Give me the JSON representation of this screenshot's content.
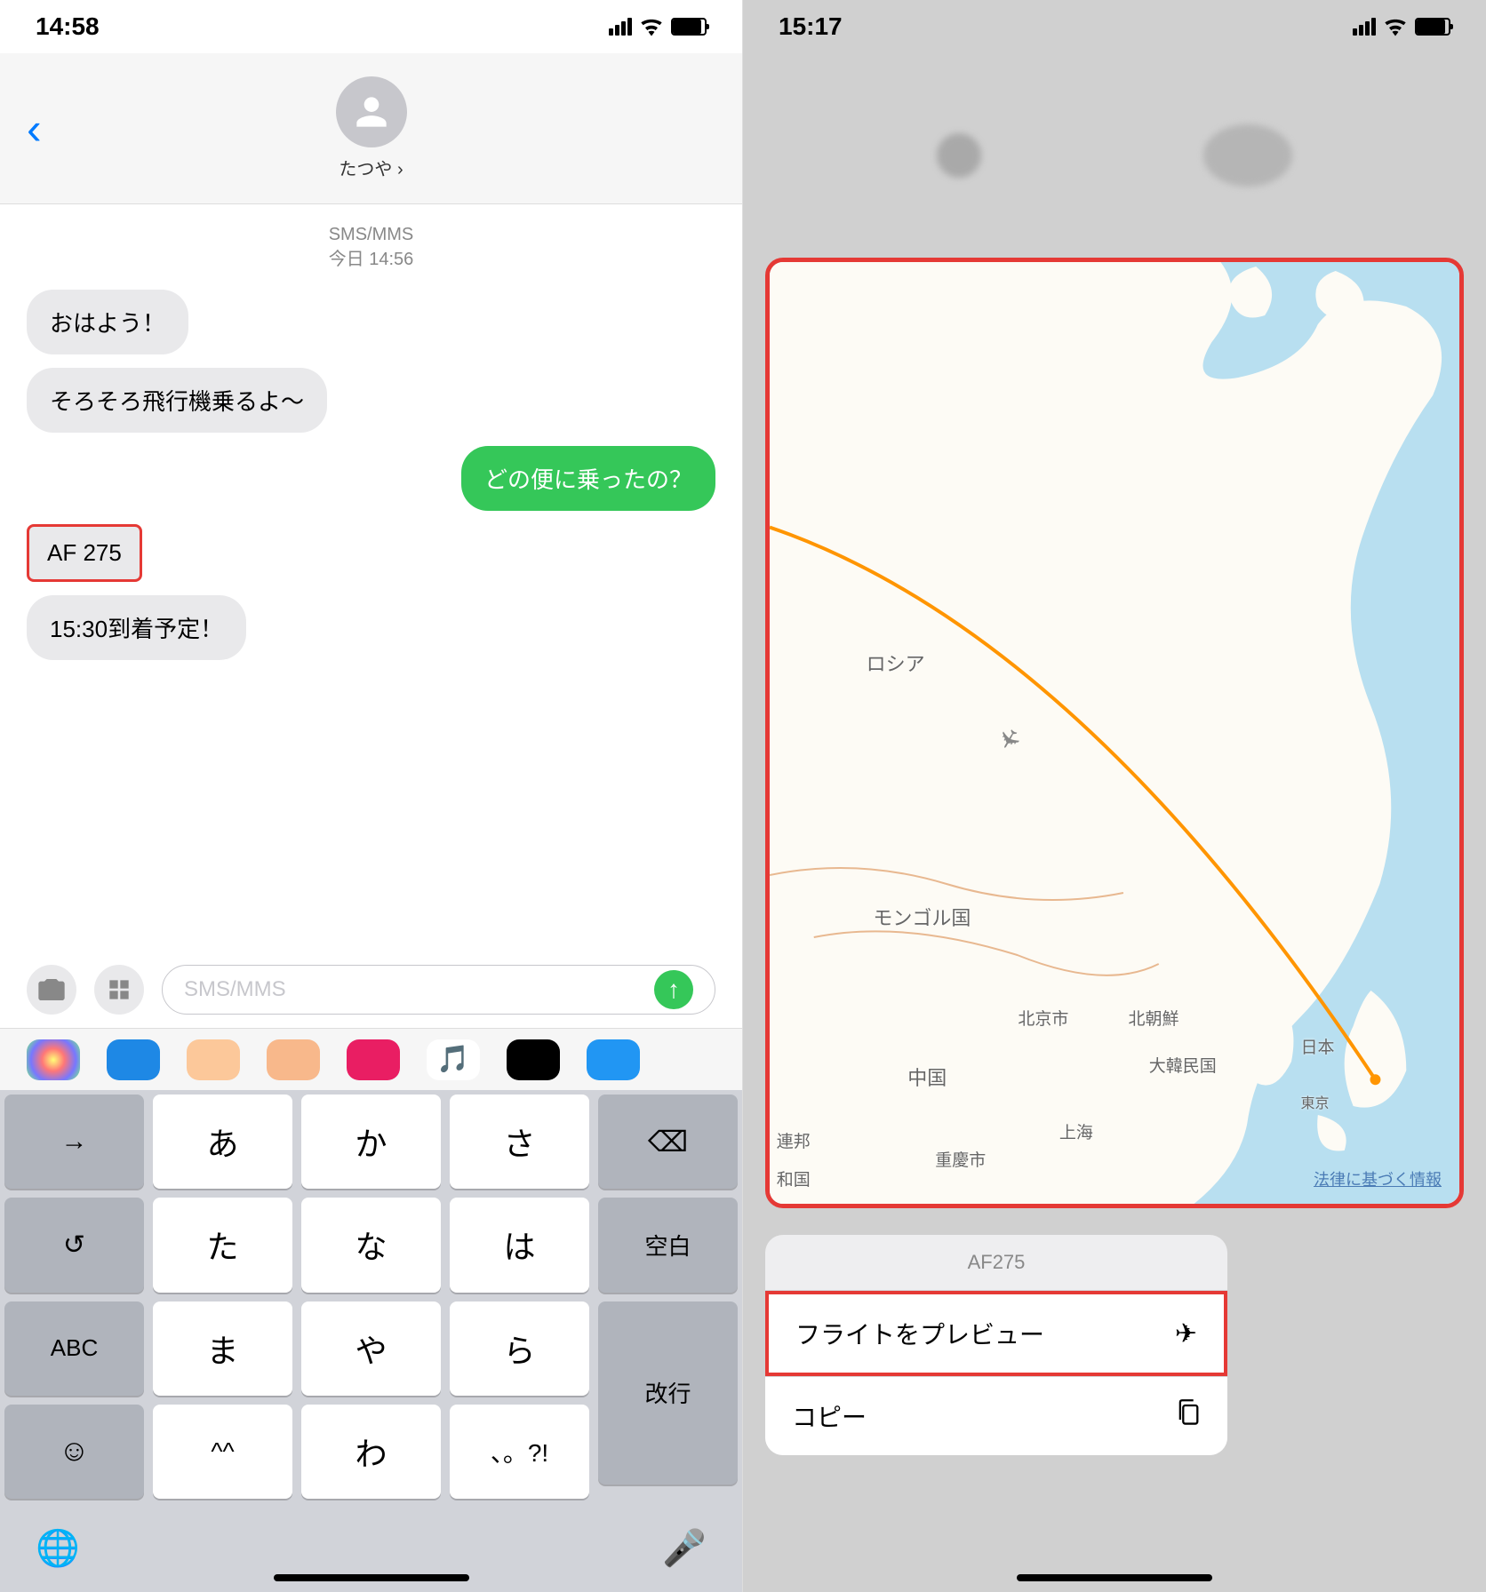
{
  "left": {
    "status": {
      "time": "14:58"
    },
    "header": {
      "contact_name": "たつや ›"
    },
    "thread": {
      "meta_line1": "SMS/MMS",
      "meta_line2": "今日 14:56",
      "messages": [
        {
          "text": "おはよう！",
          "dir": "in"
        },
        {
          "text": "そろそろ飛行機乗るよ〜",
          "dir": "in"
        },
        {
          "text": "どの便に乗ったの？",
          "dir": "out"
        },
        {
          "text": "AF 275",
          "dir": "in",
          "highlight": true
        },
        {
          "text": "15:30到着予定！",
          "dir": "in"
        }
      ]
    },
    "compose": {
      "placeholder": "SMS/MMS"
    },
    "keyboard": {
      "rows": [
        [
          "→",
          "あ",
          "か",
          "さ",
          "⌫"
        ],
        [
          "↺",
          "た",
          "な",
          "は",
          "空白"
        ],
        [
          "ABC",
          "ま",
          "や",
          "ら",
          "改行"
        ],
        [
          "☺",
          "^^",
          "わ",
          "、。?!",
          ""
        ]
      ]
    }
  },
  "right": {
    "status": {
      "time": "15:17"
    },
    "map": {
      "labels": {
        "russia": "ロシア",
        "mongolia": "モンゴル国",
        "china": "中国",
        "beijing": "北京市",
        "nkorea": "北朝鮮",
        "skorea": "大韓民国",
        "japan": "日本",
        "tokyo": "東京",
        "shanghai": "上海",
        "chongqing": "重慶市",
        "federation": "連邦",
        "koku": "和国"
      },
      "legal": "法律に基づく情報"
    },
    "context_menu": {
      "header": "AF275",
      "items": {
        "preview": "フライトをプレビュー",
        "copy": "コピー"
      }
    }
  }
}
